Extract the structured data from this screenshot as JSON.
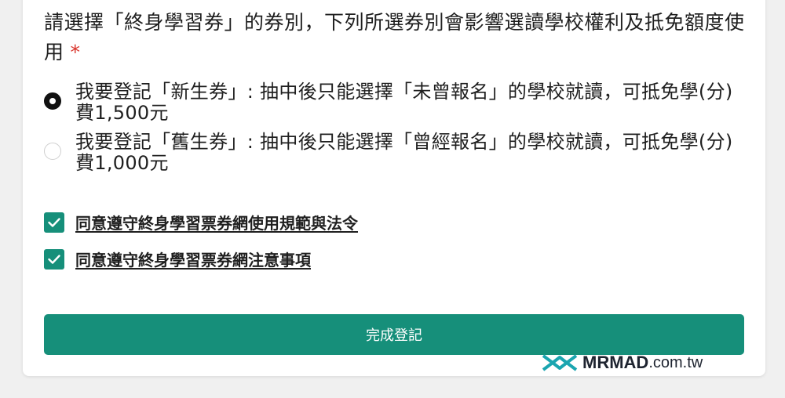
{
  "question": {
    "text": "請選擇「終身學習券」的券別，下列所選券別會影響選讀學校權利及抵免額度使用",
    "required_mark": "*"
  },
  "options": [
    {
      "label": "我要登記「新生券」: 抽中後只能選擇「未曾報名」的學校就讀，可抵免學(分)費1,500元",
      "selected": true
    },
    {
      "label": "我要登記「舊生券」: 抽中後只能選擇「曾經報名」的學校就讀，可抵免學(分)費1,000元",
      "selected": false
    }
  ],
  "agreements": [
    {
      "label": "同意遵守終身學習票券網使用規範與法令",
      "checked": true
    },
    {
      "label": "同意遵守終身學習票券網注意事項",
      "checked": true
    }
  ],
  "submit_label": "完成登記",
  "watermark": {
    "brand": "MRMAD",
    "suffix": ".com.tw"
  },
  "colors": {
    "accent": "#168f7a",
    "required": "#d9342b"
  }
}
